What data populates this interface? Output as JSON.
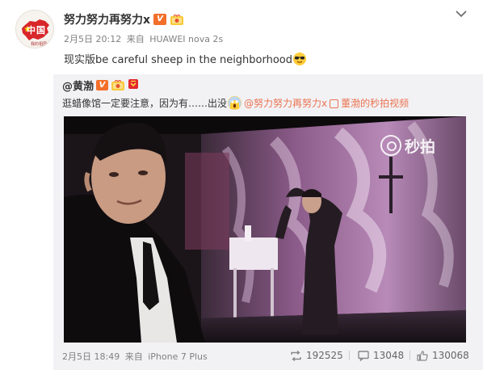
{
  "post": {
    "author": "努力努力再努力x",
    "date": "2月5日 20:12",
    "from_label": "来自",
    "device": "HUAWEI nova 2s",
    "text": "现实版be careful sheep in the neighborhood"
  },
  "avatar": {
    "text": "中国",
    "small": "我的祖国"
  },
  "repost": {
    "author": "@黄渤",
    "text": "逛蜡像馆一定要注意，因为有……出没",
    "mention": "@努力努力再努力x",
    "link": "董渤的秒拍视频",
    "date": "2月5日 18:49",
    "from_label": "来自",
    "device": "iPhone 7 Plus",
    "repost_count": "192525",
    "comment_count": "13048",
    "like_count": "130068"
  },
  "video": {
    "watermark": "秒拍"
  },
  "colors": {
    "link": "#eb7350",
    "vip": "#f36f2a",
    "repost_bg": "#f2f2f5"
  }
}
